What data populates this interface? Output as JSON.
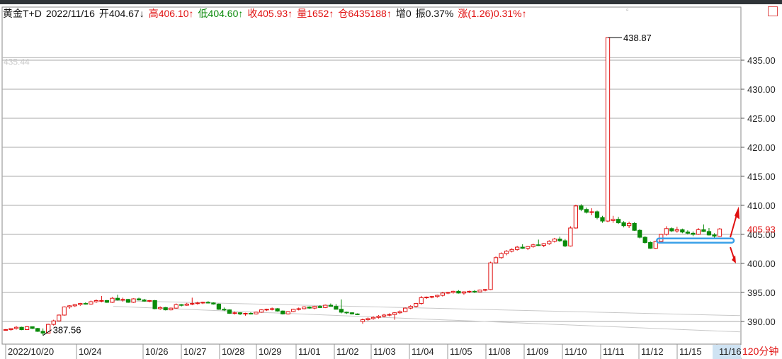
{
  "info": {
    "name": "黄金T+D",
    "date": "2022/11/16",
    "open": "开404.67↓",
    "high": "高406.10↑",
    "low": "低404.60↑",
    "close": "收405.93↑",
    "volume": "量1652↑",
    "position": "仓6435188↑",
    "increase": "增0",
    "amplitude": "振0.37%",
    "change": "涨(1.26)0.31%↑"
  },
  "period": "120分钟",
  "colors": {
    "up": "#e01010",
    "down": "#0a8a0a",
    "grid": "#aaaaaa",
    "trend": "#c8c8c8",
    "box": "#3aa0e8"
  },
  "icons": [
    "window-close-icon",
    "window-restore-icon",
    "down-arrow-icon",
    "up-arrow-icon"
  ],
  "chart_data": {
    "type": "candlestick",
    "ylim": [
      388,
      440
    ],
    "yticks": [
      "390.00",
      "395.00",
      "400.00",
      "405.00",
      "410.00",
      "415.00",
      "420.00",
      "425.00",
      "430.00",
      "435.00"
    ],
    "ytick_values": [
      390,
      395,
      400,
      405,
      410,
      415,
      420,
      425,
      430,
      435
    ],
    "xticks": [
      "2022/10/20",
      "10/24",
      "10/26",
      "10/27",
      "10/28",
      "10/29",
      "11/01",
      "11/02",
      "11/03",
      "11/04",
      "11/05",
      "11/08",
      "11/09",
      "11/10",
      "11/11",
      "11/12",
      "11/15",
      "11/16"
    ],
    "annotations": {
      "max": "438.87",
      "min": "387.56",
      "last": "405.93",
      "ghost": "435.44"
    },
    "candles": [
      [
        388.6,
        388.7,
        388.5,
        388.6
      ],
      [
        388.6,
        388.9,
        388.4,
        388.8
      ],
      [
        388.8,
        389.2,
        388.6,
        389.0
      ],
      [
        389.0,
        389.1,
        388.5,
        388.6
      ],
      [
        388.6,
        389.2,
        388.6,
        389.1
      ],
      [
        389.1,
        389.1,
        388.7,
        388.8
      ],
      [
        388.8,
        388.9,
        388.2,
        388.3
      ],
      [
        388.3,
        388.8,
        387.6,
        388.0
      ],
      [
        388.0,
        389.6,
        388.0,
        389.5
      ],
      [
        389.5,
        390.3,
        389.3,
        390.1
      ],
      [
        390.1,
        391.2,
        390.0,
        391.1
      ],
      [
        391.1,
        392.6,
        391.0,
        392.5
      ],
      [
        392.5,
        392.8,
        392.2,
        392.7
      ],
      [
        392.7,
        393.0,
        392.5,
        392.9
      ],
      [
        392.9,
        393.2,
        392.7,
        393.1
      ],
      [
        393.1,
        393.3,
        392.9,
        393.0
      ],
      [
        393.0,
        393.6,
        392.9,
        393.4
      ],
      [
        393.4,
        393.8,
        393.2,
        393.6
      ],
      [
        393.6,
        394.4,
        393.3,
        393.6
      ],
      [
        393.6,
        393.7,
        393.2,
        393.3
      ],
      [
        393.3,
        394.2,
        393.2,
        394.0
      ],
      [
        394.0,
        394.6,
        393.6,
        393.7
      ],
      [
        393.7,
        394.1,
        393.4,
        393.8
      ],
      [
        393.8,
        393.9,
        393.2,
        393.3
      ],
      [
        393.3,
        394.0,
        393.2,
        393.9
      ],
      [
        393.9,
        394.1,
        393.6,
        393.7
      ],
      [
        393.7,
        393.9,
        393.4,
        393.5
      ],
      [
        393.5,
        393.7,
        393.3,
        393.6
      ],
      [
        393.6,
        393.7,
        392.1,
        392.2
      ],
      [
        392.2,
        392.6,
        392.0,
        392.4
      ],
      [
        392.4,
        392.5,
        391.9,
        392.0
      ],
      [
        392.0,
        392.4,
        391.9,
        392.3
      ],
      [
        392.3,
        393.1,
        392.2,
        392.9
      ],
      [
        392.9,
        393.0,
        392.6,
        392.8
      ],
      [
        392.8,
        393.2,
        392.7,
        393.0
      ],
      [
        393.0,
        394.1,
        392.8,
        393.1
      ],
      [
        393.1,
        393.4,
        392.9,
        393.2
      ],
      [
        393.2,
        393.4,
        393.0,
        393.3
      ],
      [
        393.3,
        393.5,
        393.1,
        393.2
      ],
      [
        393.2,
        393.3,
        392.9,
        393.0
      ],
      [
        393.0,
        393.1,
        392.0,
        392.1
      ],
      [
        392.1,
        392.4,
        391.8,
        392.0
      ],
      [
        392.0,
        392.1,
        391.3,
        391.4
      ],
      [
        391.4,
        391.7,
        391.2,
        391.5
      ],
      [
        391.5,
        391.6,
        391.1,
        391.3
      ],
      [
        391.3,
        391.5,
        391.0,
        391.4
      ],
      [
        391.4,
        391.6,
        391.2,
        391.3
      ],
      [
        391.3,
        391.7,
        391.2,
        391.6
      ],
      [
        391.6,
        392.1,
        391.5,
        392.0
      ],
      [
        392.0,
        392.2,
        391.8,
        392.1
      ],
      [
        392.1,
        392.4,
        391.9,
        392.2
      ],
      [
        392.2,
        392.3,
        391.7,
        391.8
      ],
      [
        391.8,
        391.9,
        391.2,
        391.3
      ],
      [
        391.3,
        391.8,
        391.2,
        391.7
      ],
      [
        391.7,
        392.2,
        391.6,
        392.1
      ],
      [
        392.1,
        392.4,
        391.9,
        392.2
      ],
      [
        392.2,
        392.6,
        392.1,
        392.5
      ],
      [
        392.5,
        392.6,
        392.2,
        392.3
      ],
      [
        392.3,
        392.7,
        392.1,
        392.6
      ],
      [
        392.6,
        392.8,
        392.3,
        392.4
      ],
      [
        392.4,
        392.9,
        392.3,
        392.8
      ],
      [
        392.8,
        393.1,
        392.7,
        392.6
      ],
      [
        392.6,
        393.0,
        392.4,
        392.1
      ],
      [
        392.1,
        393.8,
        391.4,
        391.6
      ],
      [
        391.6,
        391.7,
        391.3,
        391.5
      ],
      [
        391.5,
        391.6,
        391.2,
        391.3
      ],
      [
        391.3,
        391.4,
        391.1,
        391.2
      ],
      [
        390.0,
        390.5,
        389.6,
        390.3
      ],
      [
        390.3,
        390.7,
        390.1,
        390.5
      ],
      [
        390.5,
        390.9,
        390.3,
        390.7
      ],
      [
        390.7,
        391.1,
        390.5,
        390.9
      ],
      [
        390.9,
        391.3,
        390.7,
        391.1
      ],
      [
        391.1,
        391.4,
        390.9,
        391.2
      ],
      [
        391.2,
        391.6,
        390.3,
        391.5
      ],
      [
        391.5,
        391.9,
        391.3,
        391.7
      ],
      [
        391.7,
        392.4,
        391.6,
        392.3
      ],
      [
        392.3,
        392.8,
        392.1,
        392.6
      ],
      [
        392.6,
        393.2,
        392.4,
        393.1
      ],
      [
        393.1,
        394.4,
        392.9,
        394.1
      ],
      [
        394.1,
        394.3,
        393.9,
        394.2
      ],
      [
        394.2,
        394.4,
        394.0,
        394.3
      ],
      [
        394.3,
        394.6,
        394.1,
        394.5
      ],
      [
        394.5,
        395.1,
        394.3,
        394.9
      ],
      [
        394.9,
        395.1,
        394.7,
        395.0
      ],
      [
        395.0,
        395.3,
        394.8,
        395.2
      ],
      [
        395.2,
        395.4,
        394.8,
        394.9
      ],
      [
        394.9,
        395.2,
        394.6,
        395.1
      ],
      [
        395.1,
        395.3,
        394.9,
        395.2
      ],
      [
        395.2,
        395.4,
        394.9,
        395.1
      ],
      [
        395.1,
        395.5,
        395.0,
        395.4
      ],
      [
        395.4,
        395.6,
        395.2,
        395.5
      ],
      [
        395.5,
        400.3,
        395.4,
        400.1
      ],
      [
        400.1,
        401.2,
        400.0,
        401.0
      ],
      [
        401.0,
        401.9,
        400.8,
        401.7
      ],
      [
        401.7,
        402.3,
        401.4,
        402.1
      ],
      [
        402.1,
        402.6,
        401.9,
        402.4
      ],
      [
        402.4,
        403.0,
        402.2,
        402.8
      ],
      [
        402.8,
        403.3,
        402.5,
        402.6
      ],
      [
        402.6,
        403.0,
        402.3,
        402.9
      ],
      [
        402.9,
        403.4,
        402.7,
        403.2
      ],
      [
        403.2,
        404.1,
        403.0,
        403.1
      ],
      [
        403.1,
        403.5,
        402.8,
        403.4
      ],
      [
        403.4,
        404.0,
        403.2,
        403.8
      ],
      [
        403.8,
        404.4,
        403.6,
        404.2
      ],
      [
        404.2,
        404.6,
        403.7,
        403.9
      ],
      [
        403.9,
        404.2,
        402.8,
        403.0
      ],
      [
        403.0,
        406.4,
        402.9,
        406.1
      ],
      [
        406.1,
        410.1,
        406.0,
        409.9
      ],
      [
        409.9,
        410.2,
        409.0,
        409.3
      ],
      [
        409.3,
        409.6,
        408.6,
        408.8
      ],
      [
        408.8,
        409.5,
        408.3,
        408.9
      ],
      [
        408.9,
        409.1,
        407.6,
        407.9
      ],
      [
        407.9,
        408.2,
        407.0,
        407.3
      ],
      [
        407.3,
        438.9,
        407.1,
        438.9
      ],
      [
        407.4,
        408.2,
        407.0,
        407.6
      ],
      [
        407.6,
        408.0,
        406.8,
        407.0
      ],
      [
        407.0,
        407.3,
        406.2,
        406.5
      ],
      [
        406.5,
        407.2,
        406.1,
        406.9
      ],
      [
        406.9,
        407.1,
        405.6,
        405.7
      ],
      [
        405.7,
        405.9,
        404.3,
        404.5
      ],
      [
        404.5,
        404.7,
        403.4,
        403.6
      ],
      [
        403.6,
        403.8,
        402.5,
        402.6
      ],
      [
        402.6,
        403.9,
        402.5,
        403.8
      ],
      [
        403.8,
        405.1,
        403.6,
        405.0
      ],
      [
        405.0,
        406.4,
        404.8,
        406.0
      ],
      [
        406.0,
        406.2,
        405.4,
        405.6
      ],
      [
        405.6,
        406.3,
        405.3,
        405.8
      ],
      [
        405.8,
        406.0,
        405.2,
        405.4
      ],
      [
        405.4,
        405.7,
        405.0,
        405.2
      ],
      [
        405.2,
        405.5,
        404.7,
        405.0
      ],
      [
        405.0,
        406.1,
        404.9,
        405.8
      ],
      [
        405.8,
        406.7,
        405.4,
        405.5
      ],
      [
        405.5,
        406.1,
        404.8,
        404.9
      ],
      [
        404.9,
        405.2,
        404.4,
        404.7
      ],
      [
        404.67,
        406.1,
        404.6,
        405.93
      ]
    ]
  }
}
